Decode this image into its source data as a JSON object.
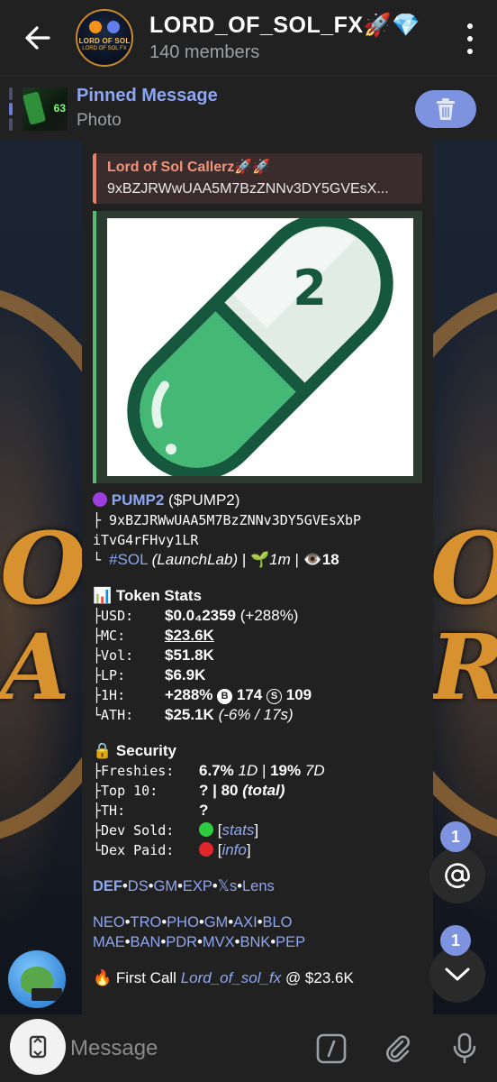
{
  "header": {
    "title": "LORD_OF_SOL_FX🚀💎",
    "members": "140 members",
    "avatar_text_1": "LORD OF SOL",
    "avatar_text_2": "LORD OF SOL FX"
  },
  "pinned": {
    "title": "Pinned Message",
    "subtitle": "Photo",
    "thumb_text": "63"
  },
  "reply": {
    "name": "Lord of Sol Callerz🚀🚀",
    "text": "9xBZJRWwUAA5M7BzZNNv3DY5GVEsX..."
  },
  "photo": {
    "pill_number": "2"
  },
  "token": {
    "name": "PUMP2",
    "ticker": "($PUMP2)",
    "address_1": "├ 9xBZJRWwUAA5M7BzZNNv3DY5GVEsXbP",
    "address_2": "iTvG4rFHvy1LR",
    "chain_prefix": "└ ",
    "chain_tag": "#SOL",
    "launchpad": "(LaunchLab)",
    "age_icon": "🌱",
    "age": "1m",
    "views_icon": "👁️",
    "views": "18"
  },
  "stats": {
    "heading": "Token Stats",
    "rows": [
      {
        "label": "├USD:",
        "value": "$0.0₄2359",
        "extra": " (+288%)"
      },
      {
        "label": "├MC:",
        "value": "$23.6K",
        "extra": ""
      },
      {
        "label": "├Vol:",
        "value": "$51.8K",
        "extra": ""
      },
      {
        "label": "├LP:",
        "value": "$6.9K",
        "extra": ""
      }
    ],
    "h1_label": "├1H:",
    "h1_change": "+288%",
    "h1_buys": "174",
    "h1_sells": "109",
    "buy_letter": "B",
    "sell_letter": "S",
    "ath_label": "└ATH:",
    "ath_value": "$25.1K",
    "ath_extra": "(-6% / 17s)"
  },
  "security": {
    "heading": "Security",
    "freshies_label": "├Freshies:",
    "freshies_value_1": "6.7%",
    "freshies_period_1": "1D",
    "freshies_value_2": "19%",
    "freshies_period_2": "7D",
    "top10_label": "├Top 10:",
    "top10_value": "? | 80",
    "top10_extra": "(total)",
    "th_label": "├TH:",
    "th_value": "?",
    "dev_label": "├Dev Sold:",
    "dev_link": "stats",
    "dex_label": "└Dex Paid:",
    "dex_link": "info",
    "green": "#2ecc40",
    "red": "#e0262b"
  },
  "links_1": [
    "DEF",
    "DS",
    "GM",
    "EXP",
    "𝕏s",
    "Lens"
  ],
  "links_2": [
    "NEO",
    "TRO",
    "PHO",
    "GM",
    "AXI",
    "BLO"
  ],
  "links_3": [
    "MAE",
    "BAN",
    "PDR",
    "MVX",
    "BNK",
    "PEP"
  ],
  "first_call": {
    "prefix": "First Call ",
    "user": "Lord_of_sol_fx",
    "suffix": " @ $23.6K"
  },
  "fab": {
    "mention_badge": "1",
    "scroll_badge": "1"
  },
  "input": {
    "placeholder": "Message"
  },
  "colors": {
    "accent": "#7d93df",
    "link": "#8ea6f2",
    "bubble": "#212121",
    "reply_accent": "#e5806c",
    "photo_accent": "#59b873"
  }
}
